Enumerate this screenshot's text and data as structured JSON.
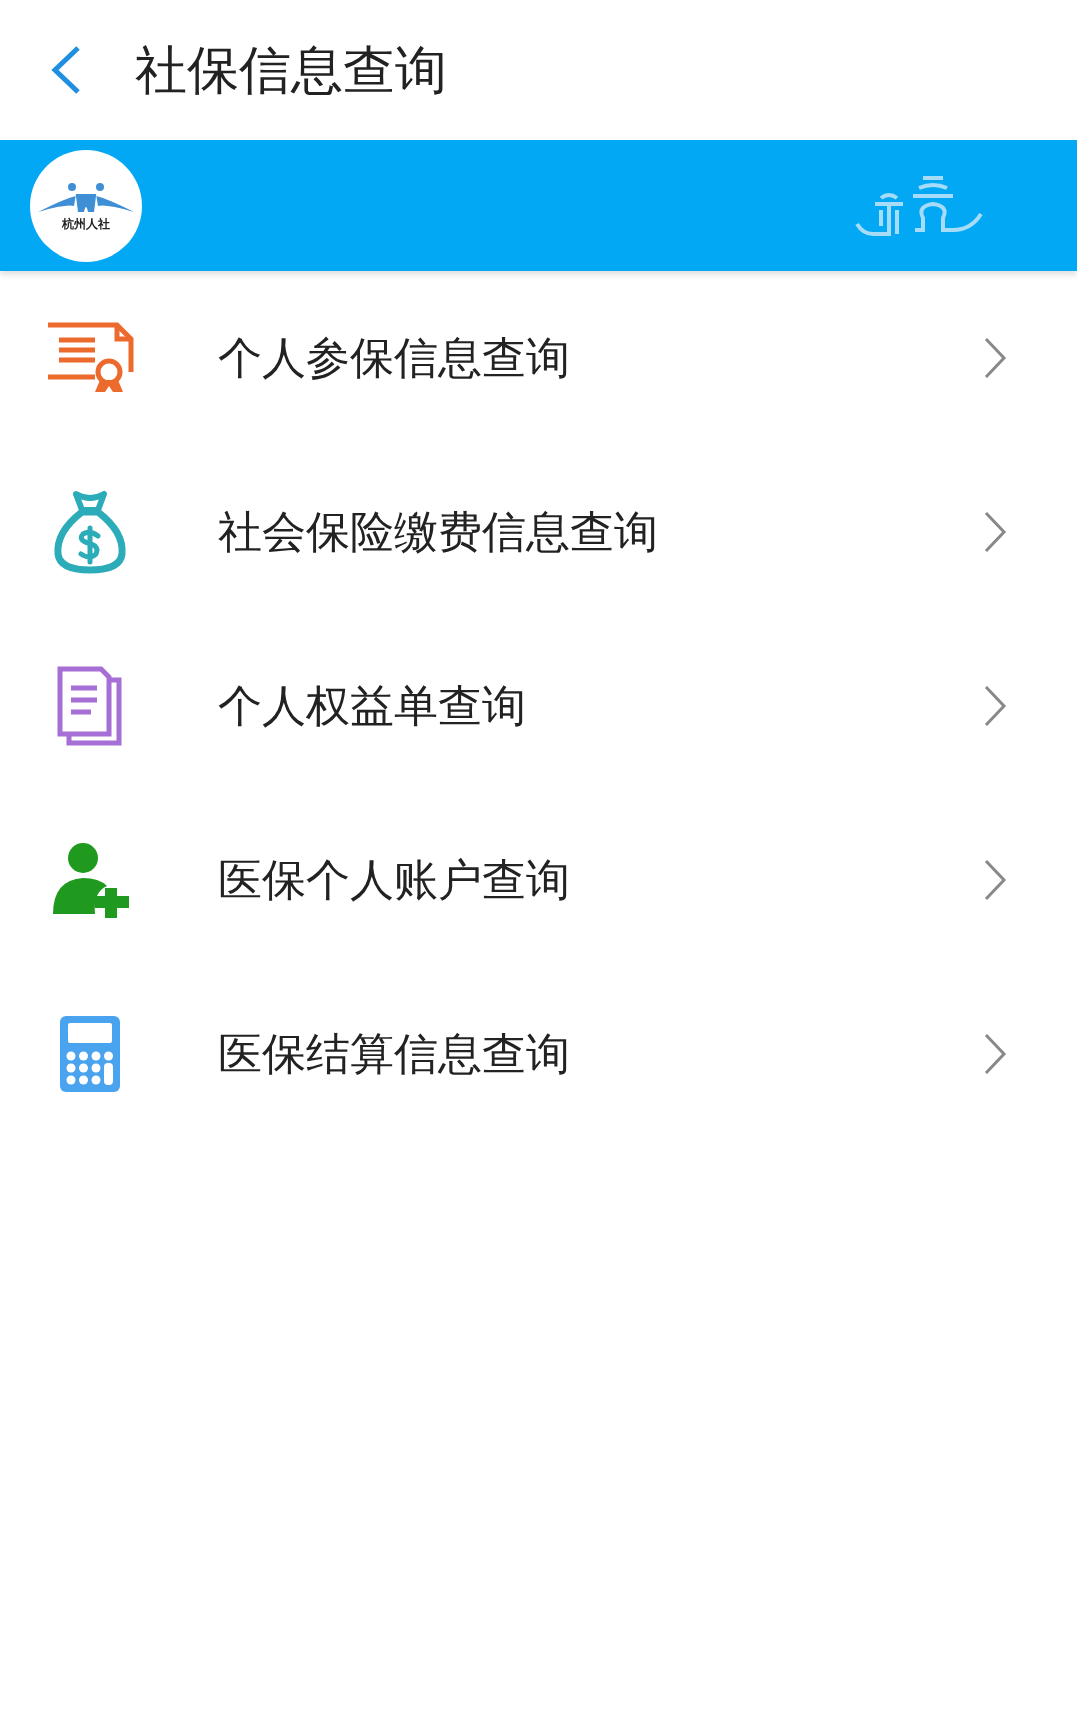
{
  "header": {
    "title": "社保信息查询"
  },
  "banner": {
    "logo_text": "杭州人社"
  },
  "menu": [
    {
      "label": "个人参保信息查询"
    },
    {
      "label": "社会保险缴费信息查询"
    },
    {
      "label": "个人权益单查询"
    },
    {
      "label": "医保个人账户查询"
    },
    {
      "label": "医保结算信息查询"
    }
  ]
}
